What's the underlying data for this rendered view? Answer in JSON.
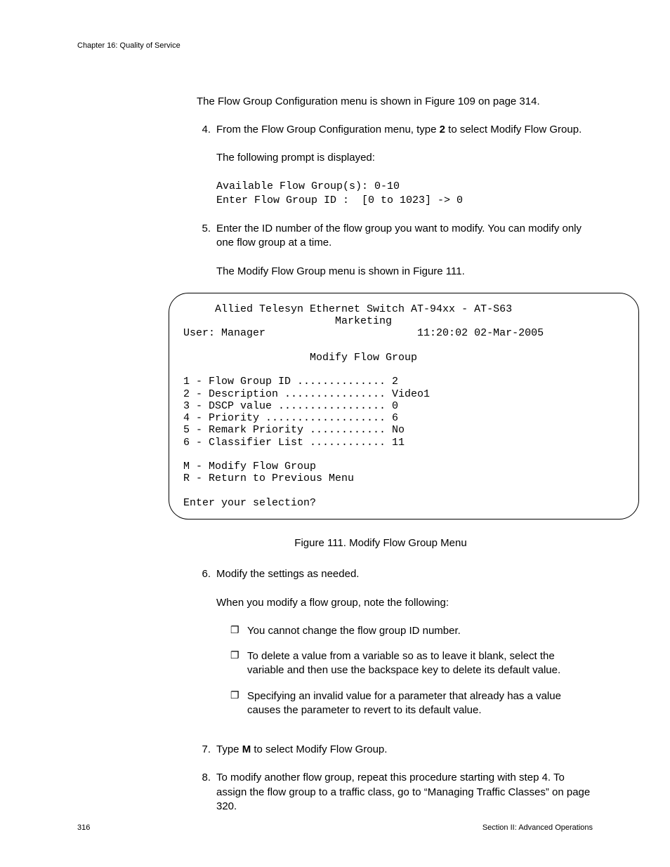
{
  "header": {
    "chapter": "Chapter 16: Quality of Service"
  },
  "intro_para": "The Flow Group Configuration menu is shown in Figure 109 on page 314.",
  "step4": {
    "num": "4.",
    "line1_a": "From the Flow Group Configuration menu, type ",
    "line1_bold": "2",
    "line1_b": " to select Modify Flow Group.",
    "line2": "The following prompt is displayed:",
    "prompt": "Available Flow Group(s): 0-10\nEnter Flow Group ID :  [0 to 1023] -> 0"
  },
  "step5": {
    "num": "5.",
    "line1": "Enter the ID number of the flow group you want to modify. You can modify only one flow group at a time.",
    "line2": "The Modify Flow Group menu is shown in Figure 111."
  },
  "terminal": "     Allied Telesyn Ethernet Switch AT-94xx - AT-S63\n                        Marketing\nUser: Manager                        11:20:02 02-Mar-2005\n\n                    Modify Flow Group\n\n1 - Flow Group ID .............. 2\n2 - Description ................ Video1\n3 - DSCP value ................. 0\n4 - Priority ................... 6\n5 - Remark Priority ............ No\n6 - Classifier List ............ 11\n\nM - Modify Flow Group\nR - Return to Previous Menu\n\nEnter your selection?",
  "figcap": "Figure 111. Modify Flow Group Menu",
  "step6": {
    "num": "6.",
    "line1": "Modify the settings as needed.",
    "line2": "When you modify a flow group, note the following:",
    "bullets": [
      "You cannot change the flow group ID number.",
      "To delete a value from a variable so as to leave it blank, select the variable and then use the backspace key to delete its default value.",
      "Specifying an invalid value for a parameter that already has a value causes the parameter to revert to its default value."
    ]
  },
  "step7": {
    "num": "7.",
    "a": "Type ",
    "bold": "M",
    "b": " to select Modify Flow Group."
  },
  "step8": {
    "num": "8.",
    "text": "To modify another flow group, repeat this procedure starting with step 4. To assign the flow group to a traffic class, go to “Managing Traffic Classes” on page 320."
  },
  "footer": {
    "page": "316",
    "section": "Section II: Advanced Operations"
  }
}
